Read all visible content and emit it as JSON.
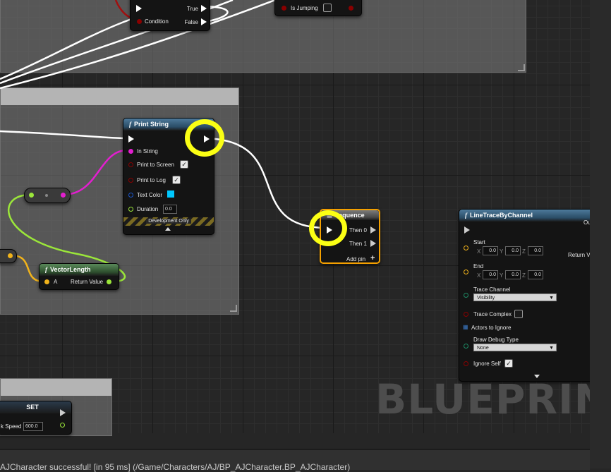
{
  "watermark": "BLUEPRINT",
  "status_text": "AJCharacter successful! [in 95 ms] (/Game/Characters/AJ/BP_AJCharacter.BP_AJCharacter)",
  "branch": {
    "true_label": "True",
    "false_label": "False",
    "condition_label": "Condition"
  },
  "is_jumping": {
    "label": "Is Jumping"
  },
  "print_string": {
    "title": "Print String",
    "in_string": "In String",
    "print_to_screen": "Print to Screen",
    "print_to_log": "Print to Log",
    "text_color": "Text Color",
    "duration": "Duration",
    "duration_value": "0.0",
    "dev_only": "Development Only",
    "text_color_swatch": "#00c8ff"
  },
  "sequence": {
    "title": "Sequence",
    "then0": "Then 0",
    "then1": "Then 1",
    "add_pin": "Add pin"
  },
  "vector_length": {
    "title": "VectorLength",
    "a": "A",
    "return_value": "Return Value"
  },
  "line_trace": {
    "title": "LineTraceByChannel",
    "start": "Start",
    "end": "End",
    "x": "X",
    "y": "Y",
    "z": "Z",
    "zero": "0.0",
    "trace_channel": "Trace Channel",
    "trace_channel_value": "Visibility",
    "trace_complex": "Trace Complex",
    "actors_to_ignore": "Actors to Ignore",
    "draw_debug_type": "Draw Debug Type",
    "draw_debug_value": "None",
    "ignore_self": "Ignore Self",
    "out_partial": "Ou",
    "return_partial": "Return V"
  },
  "set_node": {
    "title": "SET",
    "label_partial": "k Speed",
    "value": "600.0"
  }
}
